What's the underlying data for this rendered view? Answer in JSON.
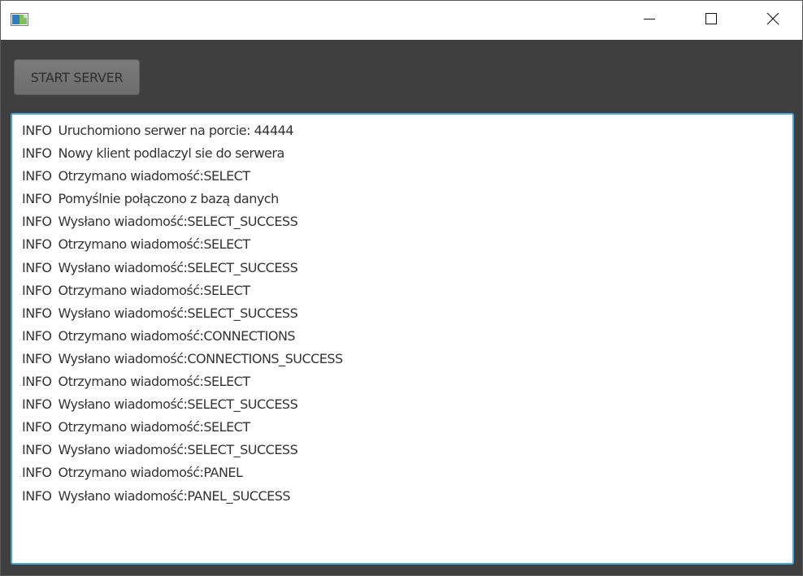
{
  "window": {
    "icons": {
      "app": "app-window-icon",
      "minimize": "minimize-icon",
      "maximize": "maximize-icon",
      "close": "close-icon"
    }
  },
  "toolbar": {
    "start_label": "START SERVER"
  },
  "log": {
    "lines": [
      {
        "level": "INFO",
        "message": "Uruchomiono serwer na porcie: 44444"
      },
      {
        "level": "INFO",
        "message": "Nowy klient podlaczyl sie do serwera"
      },
      {
        "level": "INFO",
        "message": "Otrzymano wiadomość:SELECT"
      },
      {
        "level": "INFO",
        "message": "Pomyślnie połączono z bazą danych"
      },
      {
        "level": "INFO",
        "message": "Wysłano wiadomość:SELECT_SUCCESS"
      },
      {
        "level": "INFO",
        "message": "Otrzymano wiadomość:SELECT"
      },
      {
        "level": "INFO",
        "message": "Wysłano wiadomość:SELECT_SUCCESS"
      },
      {
        "level": "INFO",
        "message": "Otrzymano wiadomość:SELECT"
      },
      {
        "level": "INFO",
        "message": "Wysłano wiadomość:SELECT_SUCCESS"
      },
      {
        "level": "INFO",
        "message": "Otrzymano wiadomość:CONNECTIONS"
      },
      {
        "level": "INFO",
        "message": "Wysłano wiadomość:CONNECTIONS_SUCCESS"
      },
      {
        "level": "INFO",
        "message": "Otrzymano wiadomość:SELECT"
      },
      {
        "level": "INFO",
        "message": "Wysłano wiadomość:SELECT_SUCCESS"
      },
      {
        "level": "INFO",
        "message": "Otrzymano wiadomość:SELECT"
      },
      {
        "level": "INFO",
        "message": "Wysłano wiadomość:SELECT_SUCCESS"
      },
      {
        "level": "INFO",
        "message": "Otrzymano wiadomość:PANEL"
      },
      {
        "level": "INFO",
        "message": "Wysłano wiadomość:PANEL_SUCCESS"
      }
    ]
  },
  "colors": {
    "background": "#3f3f3f",
    "titlebar": "#ffffff",
    "focus_border": "#49a5d6",
    "button": "#727272",
    "text": "#333333"
  }
}
